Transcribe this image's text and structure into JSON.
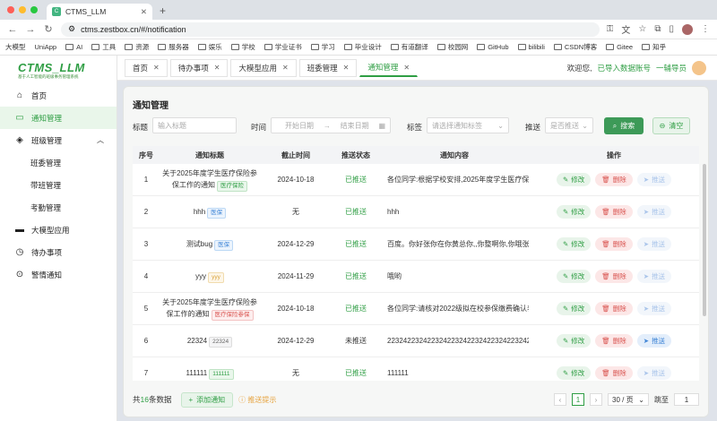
{
  "browser": {
    "tab_title": "CTMS_LLM",
    "url": "ctms.zestbox.cn/#/notification",
    "bookmarks": [
      "大模型",
      "UniApp",
      "AI",
      "工具",
      "资源",
      "服务器",
      "娱乐",
      "学校",
      "学业证书",
      "学习",
      "毕业设计",
      "有道翻译",
      "校园网",
      "GitHub",
      "bilibili",
      "CSDN博客",
      "Gitee",
      "知乎"
    ]
  },
  "logo": {
    "title": "CTMS_LLM",
    "subtitle": "基于人工智能的班级事务管理系统"
  },
  "sidebar": {
    "items": [
      {
        "label": "首页",
        "icon": "home-icon"
      },
      {
        "label": "通知管理",
        "icon": "message-icon"
      },
      {
        "label": "班级管理",
        "icon": "class-icon"
      },
      {
        "label": "大模型应用",
        "icon": "monitor-icon"
      },
      {
        "label": "待办事项",
        "icon": "todo-icon"
      },
      {
        "label": "警情通知",
        "icon": "alert-icon"
      }
    ],
    "sub_items": [
      "班委管理",
      "带班管理",
      "考勤管理"
    ]
  },
  "page_tabs": [
    "首页",
    "待办事项",
    "大模型应用",
    "班委管理",
    "通知管理"
  ],
  "welcome": {
    "text": "欢迎您,",
    "status": "已导入数据账号",
    "role": "一辅导员"
  },
  "card": {
    "title": "通知管理"
  },
  "filters": {
    "title_label": "标题",
    "title_placeholder": "输入标题",
    "time_label": "时间",
    "start_placeholder": "开始日期",
    "end_placeholder": "结束日期",
    "tag_label": "标签",
    "tag_placeholder": "请选择通知标签",
    "push_label": "推送",
    "push_placeholder": "是否推送",
    "search_btn": "搜索",
    "clear_btn": "清空"
  },
  "table": {
    "headers": [
      "序号",
      "通知标题",
      "截止时间",
      "推送状态",
      "通知内容",
      "操作"
    ],
    "rows": [
      {
        "no": "1",
        "title": "关于2025年度学生医疗保险参保工作的通知",
        "tag": "医疗保险",
        "tag_color": "green",
        "deadline": "2024-10-18",
        "status": "已推送",
        "content": "各位同学:根据学校安排,2025年度学生医疗保...",
        "push_on": false
      },
      {
        "no": "2",
        "title": "hhh",
        "tag": "医保",
        "tag_color": "blue",
        "deadline": "无",
        "status": "已推送",
        "content": "hhh",
        "push_on": false
      },
      {
        "no": "3",
        "title": "测试bug",
        "tag": "医保",
        "tag_color": "blue",
        "deadline": "2024-12-29",
        "status": "已推送",
        "content": "百度。你好张你在你黄总你,,你整啊你,你哦张...",
        "push_on": false
      },
      {
        "no": "4",
        "title": "yyy",
        "tag": "yyy",
        "tag_color": "yellow",
        "deadline": "2024-11-29",
        "status": "已推送",
        "content": "哦哟",
        "push_on": false
      },
      {
        "no": "5",
        "title": "关于2025年度学生医疗保险参保工作的通知",
        "tag": "医疗保险参保",
        "tag_color": "red",
        "deadline": "2024-10-18",
        "status": "已推送",
        "content": "各位同学:请核对2022级拟在校参保缴费确认表...",
        "push_on": false
      },
      {
        "no": "6",
        "title": "22324",
        "tag": "22324",
        "tag_color": "gray",
        "deadline": "2024-12-29",
        "status": "未推送",
        "content": "2232422324223242232422324223242232422324...",
        "push_on": true
      },
      {
        "no": "7",
        "title": "111111",
        "tag": "111111",
        "tag_color": "green",
        "deadline": "无",
        "status": "已推送",
        "content": "111111",
        "push_on": false
      }
    ],
    "op_labels": {
      "edit": "修改",
      "delete": "删除",
      "push": "推送"
    }
  },
  "footer": {
    "total_prefix": "共",
    "total_count": "16",
    "total_suffix": "条数据",
    "add_btn": "添加通知",
    "push_tip": "推送提示",
    "page": "1",
    "page_size": "30 / 页",
    "goto_label": "跳至",
    "goto_value": "1"
  },
  "colors": {
    "accent": "#2f9e44",
    "danger": "#d9534f",
    "info": "#3d84d6",
    "warning": "#e6a23c"
  }
}
